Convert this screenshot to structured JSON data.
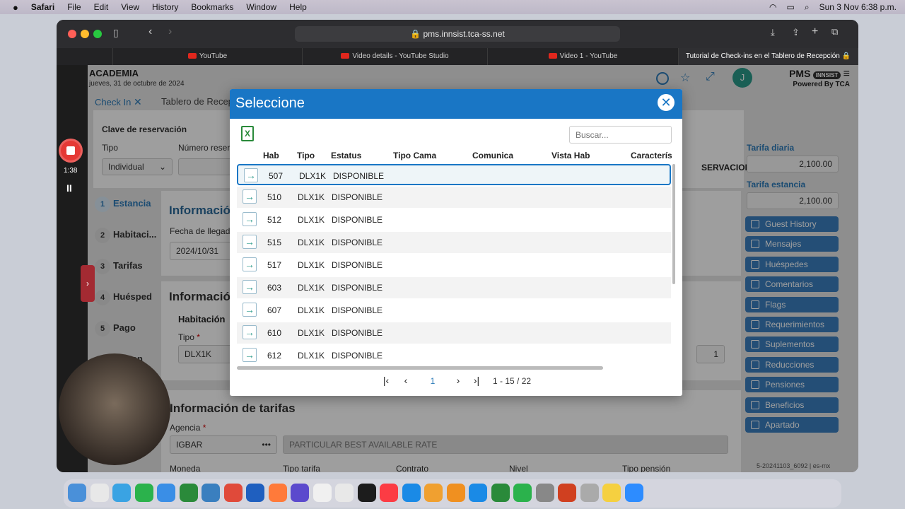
{
  "menubar": {
    "apple": "",
    "app": "Safari",
    "items": [
      "File",
      "Edit",
      "View",
      "History",
      "Bookmarks",
      "Window",
      "Help"
    ],
    "datetime": "Sun 3 Nov  6:38 p.m."
  },
  "browser": {
    "url": "pms.innsist.tca-ss.net",
    "tabs": [
      "YouTube",
      "Video details - YouTube Studio",
      "Video 1 - YouTube",
      "Tutorial de Check-ins en el Tablero de Recepción 🔒"
    ]
  },
  "recorder": {
    "time": "1:38"
  },
  "app": {
    "title": "ACADEMIA",
    "date": "jueves, 31 de octubre de 2024",
    "brand": "PMS",
    "brand_badge": "INNSIST",
    "powered": "Powered By TCA",
    "tabs": [
      "Check In",
      "Tablero de Recep"
    ],
    "clave_label": "Clave de reservación",
    "tipo_label": "Tipo",
    "tipo_value": "Individual",
    "numero_label": "Número reser",
    "reservacion_btn": "SERVACION",
    "steps": [
      {
        "num": "1",
        "label": "Estancia"
      },
      {
        "num": "2",
        "label": "Habitaci..."
      },
      {
        "num": "3",
        "label": "Tarifas"
      },
      {
        "num": "4",
        "label": "Huésped"
      },
      {
        "num": "5",
        "label": "Pago"
      },
      {
        "num": "",
        "label": "Origen"
      }
    ],
    "info1": "Informació",
    "fecha_label": "Fecha de llegada",
    "fecha_value": "2024/10/31",
    "info2": "Informació",
    "habitacion_label": "Habitación",
    "tipo2_label": "Tipo",
    "tipo2_value": "DLX1K",
    "hab_count": "1",
    "tarifas_title": "Información de tarifas",
    "agencia_label": "Agencia",
    "agencia_value": "IGBAR",
    "rate_value": "PARTICULAR BEST AVAILABLE RATE",
    "bottom_labels": [
      "Moneda",
      "Tipo tarifa",
      "Contrato",
      "Nivel",
      "Tipo pensión"
    ],
    "tarifa_diaria_label": "Tarifa diaria",
    "tarifa_diaria_value": "2,100.00",
    "tarifa_estancia_label": "Tarifa estancia",
    "tarifa_estancia_value": "2,100.00",
    "right_buttons": [
      "Guest History",
      "Mensajes",
      "Huéspedes",
      "Comentarios",
      "Flags",
      "Requerimientos",
      "Suplementos",
      "Reducciones",
      "Pensiones",
      "Beneficios",
      "Apartado"
    ],
    "version": "5-20241103_6092 | es-mx"
  },
  "modal": {
    "title": "Seleccione",
    "search_placeholder": "Buscar...",
    "columns": [
      "Hab",
      "Tipo",
      "Estatus",
      "Tipo Cama",
      "Comunica",
      "Vista Hab",
      "Caracterís"
    ],
    "rows": [
      {
        "hab": "507",
        "tipo": "DLX1K",
        "estatus": "DISPONIBLE"
      },
      {
        "hab": "510",
        "tipo": "DLX1K",
        "estatus": "DISPONIBLE"
      },
      {
        "hab": "512",
        "tipo": "DLX1K",
        "estatus": "DISPONIBLE"
      },
      {
        "hab": "515",
        "tipo": "DLX1K",
        "estatus": "DISPONIBLE"
      },
      {
        "hab": "517",
        "tipo": "DLX1K",
        "estatus": "DISPONIBLE"
      },
      {
        "hab": "603",
        "tipo": "DLX1K",
        "estatus": "DISPONIBLE"
      },
      {
        "hab": "607",
        "tipo": "DLX1K",
        "estatus": "DISPONIBLE"
      },
      {
        "hab": "610",
        "tipo": "DLX1K",
        "estatus": "DISPONIBLE"
      },
      {
        "hab": "612",
        "tipo": "DLX1K",
        "estatus": "DISPONIBLE"
      }
    ],
    "page": "1",
    "page_info": "1 - 15 / 22"
  }
}
